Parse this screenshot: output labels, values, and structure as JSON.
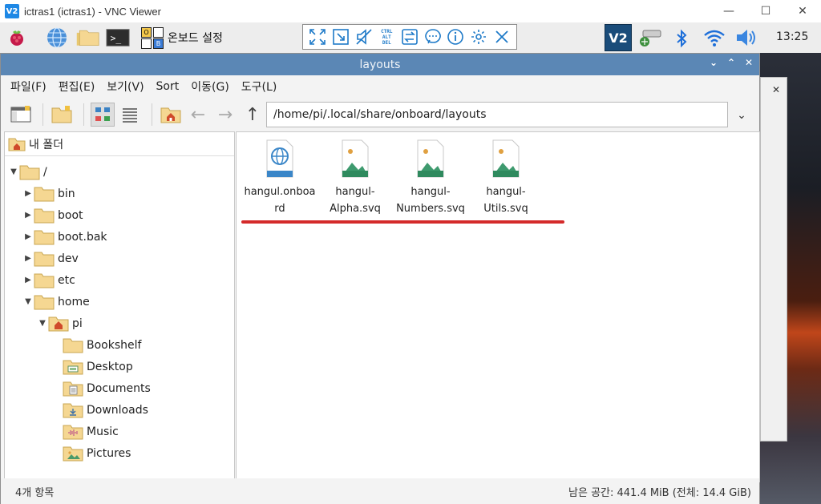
{
  "vnc": {
    "title": "ictras1 (ictras1) - VNC Viewer",
    "logo": "V2",
    "controls": [
      "minimize-icon",
      "maximize-icon",
      "close-icon"
    ]
  },
  "panel": {
    "onboard_label": "온보드 설정",
    "clock": "13:25",
    "onboard_keys": [
      "O",
      "B"
    ]
  },
  "vnc_toolbar": {
    "buttons": [
      "fullscreen-icon",
      "scale-icon",
      "mute-icon",
      "ctrl-alt-del-icon",
      "transfer-icon",
      "chat-icon",
      "info-icon",
      "settings-icon",
      "close-icon"
    ],
    "cad_label": "CTRL\nALT\nDEL"
  },
  "window": {
    "title": "layouts"
  },
  "menu": {
    "items": [
      "파일(F)",
      "편집(E)",
      "보기(V)",
      "Sort",
      "이동(G)",
      "도구(L)"
    ]
  },
  "toolbar": {
    "path": "/home/pi/.local/share/onboard/layouts"
  },
  "side": {
    "header": "내 폴더",
    "tree": [
      {
        "label": "/",
        "expanded": true,
        "icon": "folder-icon"
      },
      {
        "label": "bin",
        "expanded": false,
        "icon": "folder-icon"
      },
      {
        "label": "boot",
        "expanded": false,
        "icon": "folder-icon"
      },
      {
        "label": "boot.bak",
        "expanded": false,
        "icon": "folder-icon"
      },
      {
        "label": "dev",
        "expanded": false,
        "icon": "folder-icon"
      },
      {
        "label": "etc",
        "expanded": false,
        "icon": "folder-icon"
      },
      {
        "label": "home",
        "expanded": true,
        "icon": "folder-icon"
      },
      {
        "label": "pi",
        "expanded": true,
        "icon": "home-folder-icon"
      },
      {
        "label": "Bookshelf",
        "icon": "folder-icon"
      },
      {
        "label": "Desktop",
        "icon": "desktop-folder-icon"
      },
      {
        "label": "Documents",
        "icon": "documents-folder-icon"
      },
      {
        "label": "Downloads",
        "icon": "downloads-folder-icon"
      },
      {
        "label": "Music",
        "icon": "music-folder-icon"
      },
      {
        "label": "Pictures",
        "icon": "pictures-folder-icon"
      }
    ]
  },
  "files": [
    {
      "name": "hangul.onboard",
      "line1": "hangul.onboa",
      "line2": "rd",
      "icon": "onboard-file-icon"
    },
    {
      "name": "hangul-Alpha.svq",
      "line1": "hangul-",
      "line2": "Alpha.svq",
      "icon": "image-file-icon"
    },
    {
      "name": "hangul-Numbers.svq",
      "line1": "hangul-",
      "line2": "Numbers.svq",
      "icon": "image-file-icon"
    },
    {
      "name": "hangul-Utils.svq",
      "line1": "hangul-",
      "line2": "Utils.svq",
      "icon": "image-file-icon"
    }
  ],
  "status": {
    "left": "4개 항목",
    "right": "남은 공간: 441.4 MiB (전체: 14.4 GiB)"
  },
  "colors": {
    "accent_red": "#d42a2a",
    "titlebar": "#5b87b5",
    "folder": "#f5d792"
  }
}
